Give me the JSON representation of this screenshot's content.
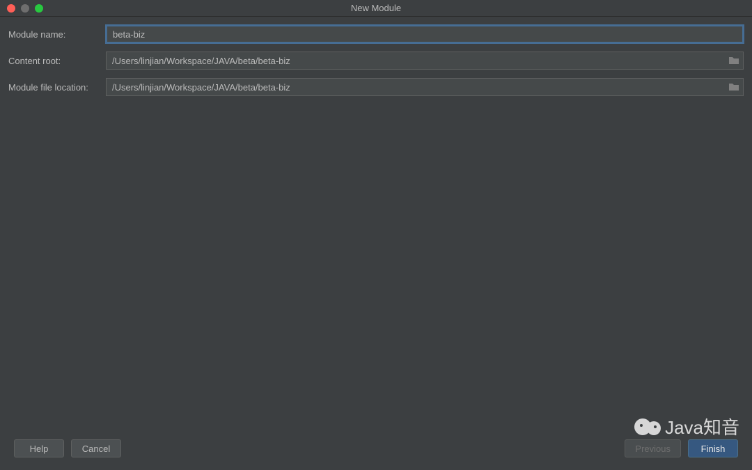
{
  "window": {
    "title": "New Module"
  },
  "form": {
    "module_name": {
      "label": "Module name:",
      "value": "beta-biz"
    },
    "content_root": {
      "label": "Content root:",
      "value": "/Users/linjian/Workspace/JAVA/beta/beta-biz"
    },
    "module_file_location": {
      "label": "Module file location:",
      "value": "/Users/linjian/Workspace/JAVA/beta/beta-biz"
    }
  },
  "buttons": {
    "help": "Help",
    "cancel": "Cancel",
    "previous": "Previous",
    "finish": "Finish"
  },
  "watermark": {
    "text": "Java知音"
  }
}
